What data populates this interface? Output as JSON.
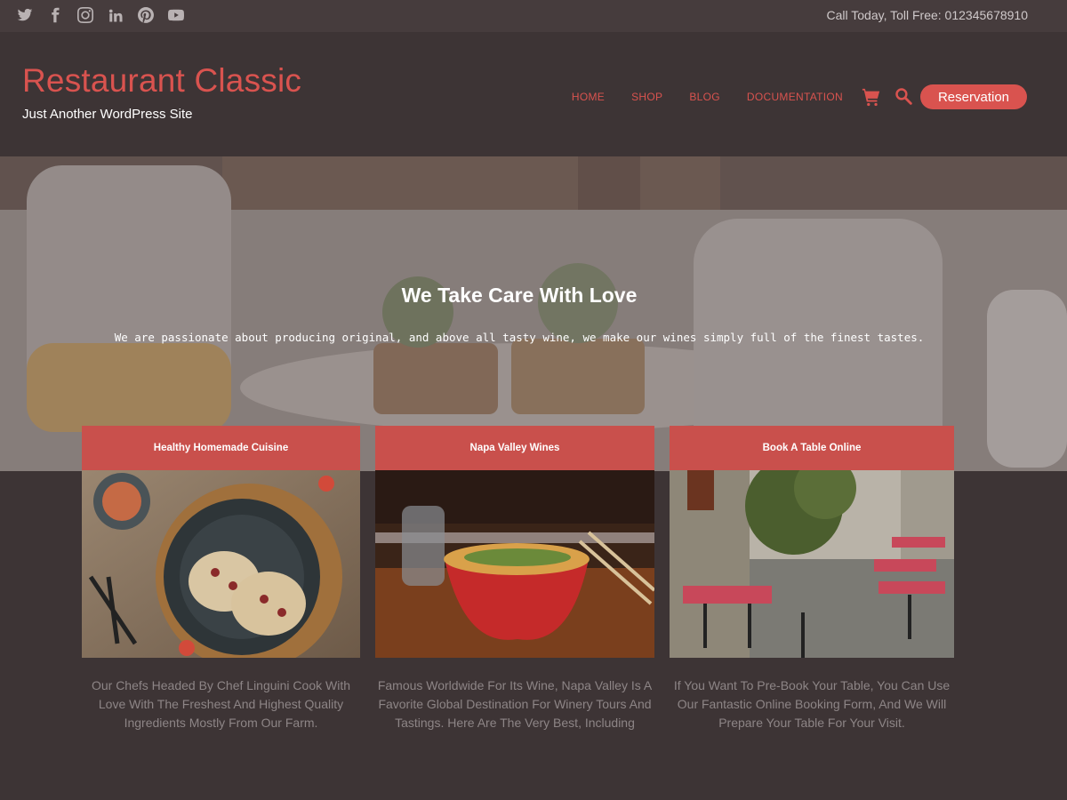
{
  "topbar": {
    "social_icons": [
      "twitter-icon",
      "facebook-icon",
      "instagram-icon",
      "linkedin-icon",
      "pinterest-icon",
      "youtube-icon"
    ],
    "call_text": "Call Today, Toll Free: 012345678910"
  },
  "header": {
    "site_title": "Restaurant Classic",
    "tagline": "Just Another WordPress Site",
    "nav": [
      "HOME",
      "SHOP",
      "BLOG",
      "DOCUMENTATION"
    ],
    "cart_icon": "cart-icon",
    "search_icon": "search-icon",
    "reservation_label": "Reservation"
  },
  "hero": {
    "title": "We Take Care With Love",
    "subtitle": "We are passionate about producing original, and above all tasty wine, we make our wines simply full of the finest tastes."
  },
  "cards": [
    {
      "heading": "Healthy Homemade Cuisine",
      "text": "Our Chefs Headed By Chef Linguini Cook With Love With The Freshest And Highest Quality Ingredients Mostly From Our Farm."
    },
    {
      "heading": "Napa Valley Wines",
      "text": "Famous Worldwide For Its Wine, Napa Valley Is A Favorite Global Destination For Winery Tours And Tastings. Here Are The Very Best, Including"
    },
    {
      "heading": "Book A Table Online",
      "text": "If You Want To Pre-Book Your Table, You Can Use Our Fantastic Online Booking Form, And We Will Prepare Your Table For Your Visit."
    }
  ],
  "colors": {
    "accent": "#d9534f",
    "card_header": "#c9504c",
    "background": "#3d3435",
    "topbar": "#463c3d"
  }
}
